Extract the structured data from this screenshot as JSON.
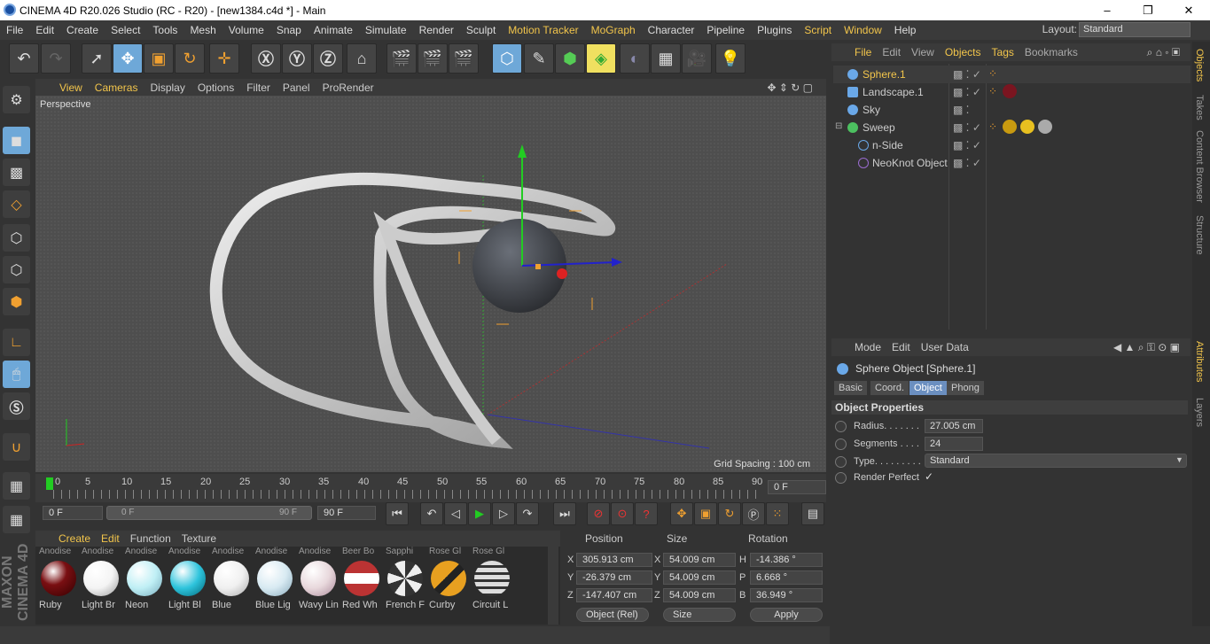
{
  "window": {
    "title": "CINEMA 4D R20.026 Studio (RC - R20) - [new1384.c4d *] - Main",
    "controls": [
      "–",
      "❐",
      "✕"
    ]
  },
  "menubar": {
    "items": [
      "File",
      "Edit",
      "Create",
      "Select",
      "Tools",
      "Mesh",
      "Volume",
      "Snap",
      "Animate",
      "Simulate",
      "Render",
      "Sculpt",
      "Motion Tracker",
      "MoGraph",
      "Character",
      "Pipeline",
      "Plugins",
      "Script",
      "Window",
      "Help"
    ],
    "layout_label": "Layout:",
    "layout_value": "Standard"
  },
  "viewport": {
    "menu": [
      "View",
      "Cameras",
      "Display",
      "Options",
      "Filter",
      "Panel",
      "ProRender"
    ],
    "camera_label": "Perspective",
    "grid_spacing": "Grid Spacing : 100 cm"
  },
  "timeline": {
    "ticks": [
      "0",
      "5",
      "10",
      "15",
      "20",
      "25",
      "30",
      "35",
      "40",
      "45",
      "50",
      "55",
      "60",
      "65",
      "70",
      "75",
      "80",
      "85",
      "90"
    ],
    "current_frame": "0 F",
    "start_field": "0 F",
    "range_start": "0 F",
    "range_end": "90 F",
    "end_field": "90 F"
  },
  "materials": {
    "menu": [
      "Create",
      "Edit",
      "Function",
      "Texture"
    ],
    "top_labels": [
      "Anodise",
      "Anodise",
      "Anodise",
      "Anodise",
      "Anodise",
      "Anodise",
      "Anodise",
      "Beer Bo",
      "Sapphi",
      "Rose Gl"
    ],
    "items": [
      {
        "name": "Ruby",
        "color": "#7a0f12"
      },
      {
        "name": "Light Br",
        "color": "#f4f4f4"
      },
      {
        "name": "Neon",
        "color": "#bfeff5"
      },
      {
        "name": "Light Bl",
        "color": "#2ec4dc"
      },
      {
        "name": "Blue",
        "color": "#f0f0f0"
      },
      {
        "name": "Blue Lig",
        "color": "#d8eaf2"
      },
      {
        "name": "Wavy Lin",
        "color": "#e8d8dc"
      },
      {
        "name": "Red Wh",
        "color": "#b33"
      },
      {
        "name": "French F",
        "color": "#ddd"
      },
      {
        "name": "Curby",
        "color": "#e8a020"
      },
      {
        "name": "Circuit L",
        "color": "#ccc"
      }
    ]
  },
  "coords": {
    "headers": [
      "Position",
      "Size",
      "Rotation"
    ],
    "rows": [
      {
        "axis": "X",
        "pos": "305.913 cm",
        "saxis": "X",
        "size": "54.009 cm",
        "raxis": "H",
        "rot": "-14.386 °"
      },
      {
        "axis": "Y",
        "pos": "-26.379 cm",
        "saxis": "Y",
        "size": "54.009 cm",
        "raxis": "P",
        "rot": "6.668 °"
      },
      {
        "axis": "Z",
        "pos": "-147.407 cm",
        "saxis": "Z",
        "size": "54.009 cm",
        "raxis": "B",
        "rot": "36.949 °"
      }
    ],
    "mode_dropdown": "Object (Rel)",
    "size_dropdown": "Size",
    "apply": "Apply"
  },
  "objects": {
    "menu": [
      "File",
      "Edit",
      "View",
      "Objects",
      "Tags",
      "Bookmarks"
    ],
    "tree": [
      {
        "name": "Sphere.1",
        "color": "#6aa8e8"
      },
      {
        "name": "Landscape.1",
        "color": "#6aa8e8"
      },
      {
        "name": "Sky",
        "color": "#6aa8e8"
      },
      {
        "name": "Sweep",
        "color": "#4cc060"
      },
      {
        "name": "n-Side",
        "color": "#6aa8e8"
      },
      {
        "name": "NeoKnot Object",
        "color": "#9a6cd0"
      }
    ]
  },
  "attributes": {
    "menu": [
      "Mode",
      "Edit",
      "User Data"
    ],
    "object_title": "Sphere Object [Sphere.1]",
    "tabs": [
      "Basic",
      "Coord.",
      "Object",
      "Phong"
    ],
    "section": "Object Properties",
    "props": [
      {
        "label": "Radius. . . . . . .",
        "value": "27.005 cm"
      },
      {
        "label": "Segments . . . .",
        "value": "24"
      },
      {
        "label": "Type. . . . . . . . .",
        "value": "Standard"
      },
      {
        "label": "Render Perfect",
        "value": "✓"
      }
    ]
  },
  "side_tabs": [
    "Objects",
    "Takes",
    "Content Browser",
    "Structure",
    "Attributes",
    "Layers"
  ]
}
